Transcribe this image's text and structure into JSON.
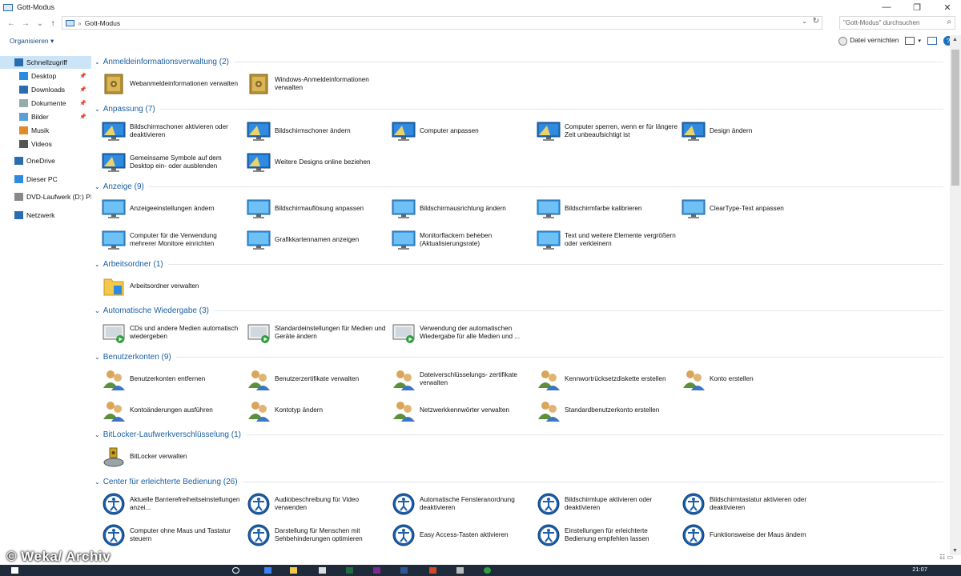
{
  "window": {
    "title": "Gott-Modus",
    "min": "—",
    "max": "❐",
    "close": "✕"
  },
  "address": {
    "back": "←",
    "fwd": "→",
    "recent": "⌄",
    "up": "↑",
    "sep": "»",
    "crumb": "Gott-Modus",
    "dd": "⌄",
    "refresh": "↻",
    "search_placeholder": "\"Gott-Modus\" durchsuchen",
    "search_icon": "⌕"
  },
  "toolbar": {
    "organize": "Organisieren ▾",
    "uninstall": "Datei vernichten",
    "help": "?"
  },
  "sidebar": {
    "items": [
      {
        "label": "Schnellzugriff",
        "icon": "star-icon",
        "selected": true
      },
      {
        "label": "Desktop",
        "icon": "desktop-icon",
        "pinned": true
      },
      {
        "label": "Downloads",
        "icon": "download-icon",
        "pinned": true
      },
      {
        "label": "Dokumente",
        "icon": "documents-icon",
        "pinned": true
      },
      {
        "label": "Bilder",
        "icon": "pictures-icon",
        "pinned": true
      },
      {
        "label": "Musik",
        "icon": "music-icon"
      },
      {
        "label": "Videos",
        "icon": "videos-icon"
      },
      {
        "label": "OneDrive",
        "icon": "onedrive-icon"
      },
      {
        "label": "Dieser PC",
        "icon": "pc-icon"
      },
      {
        "label": "DVD-Laufwerk (D:) PI",
        "icon": "dvd-icon"
      },
      {
        "label": "Netzwerk",
        "icon": "network-icon"
      }
    ]
  },
  "categories": [
    {
      "name": "Anmeldeinformationsverwaltung (2)",
      "icon": "safe-icon",
      "items": [
        "Webanmeldeinformationen verwalten",
        "Windows-Anmeldeinformationen verwalten"
      ]
    },
    {
      "name": "Anpassung (7)",
      "icon": "personalize-monitor-icon",
      "items": [
        "Bildschirmschoner aktivieren oder deaktivieren",
        "Bildschirmschoner ändern",
        "Computer anpassen",
        "Computer sperren, wenn er für längere Zeit unbeaufsichtigt ist",
        "Design ändern",
        "Gemeinsame Symbole auf dem Desktop ein- oder ausblenden",
        "Weitere Designs online beziehen"
      ]
    },
    {
      "name": "Anzeige (9)",
      "icon": "monitor-icon",
      "items": [
        "Anzeigeeinstellungen ändern",
        "Bildschirmauflösung anpassen",
        "Bildschirmausrichtung ändern",
        "Bildschirmfarbe kalibrieren",
        "ClearType-Text anpassen",
        "Computer für die Verwendung mehrerer Monitore einrichten",
        "Grafikkartennamen anzeigen",
        "Monitorflackern beheben (Aktualisierungsrate)",
        "Text und weitere Elemente vergrößern oder verkleinern"
      ]
    },
    {
      "name": "Arbeitsordner (1)",
      "icon": "work-folder-icon",
      "items": [
        "Arbeitsordner verwalten"
      ]
    },
    {
      "name": "Automatische Wiedergabe (3)",
      "icon": "autoplay-icon",
      "items": [
        "CDs und andere Medien automatisch wiedergeben",
        "Standardeinstellungen für Medien und Geräte ändern",
        "Verwendung der automatischen Wiedergabe für alle Medien und ..."
      ]
    },
    {
      "name": "Benutzerkonten (9)",
      "icon": "users-icon",
      "items": [
        "Benutzerkonten entfernen",
        "Benutzerzertifikate verwalten",
        "Dateiverschlüsselungs- zertifikate verwalten",
        "Kennwortrücksetzdiskette erstellen",
        "Konto erstellen",
        "Kontoänderungen ausführen",
        "Kontotyp ändern",
        "Netzwerkkennwörter verwalten",
        "Standardbenutzerkonto erstellen"
      ]
    },
    {
      "name": "BitLocker-Laufwerkverschlüsselung (1)",
      "icon": "bitlocker-icon",
      "items": [
        "BitLocker verwalten"
      ]
    },
    {
      "name": "Center für erleichterte Bedienung (26)",
      "icon": "ease-of-access-icon",
      "items": [
        "Aktuelle Barrierefreiheitseinstellungen anzei...",
        "Audiobeschreibung für Video verwenden",
        "Automatische Fensteranordnung deaktivieren",
        "Bildschirmlupe aktivieren oder deaktivieren",
        "Bildschirmtastatur aktivieren oder deaktivieren",
        "Computer ohne Maus und Tastatur steuern",
        "Darstellung für Menschen mit Sehbehinderungen optimieren",
        "Easy Access-Tasten aktivieren",
        "Einstellungen für erleichterte Bedienung empfehlen lassen",
        "Funktionsweise der Maus ändern"
      ]
    }
  ],
  "status": {
    "watermark": "© Weka/ Archiv",
    "clock": "21:07"
  }
}
